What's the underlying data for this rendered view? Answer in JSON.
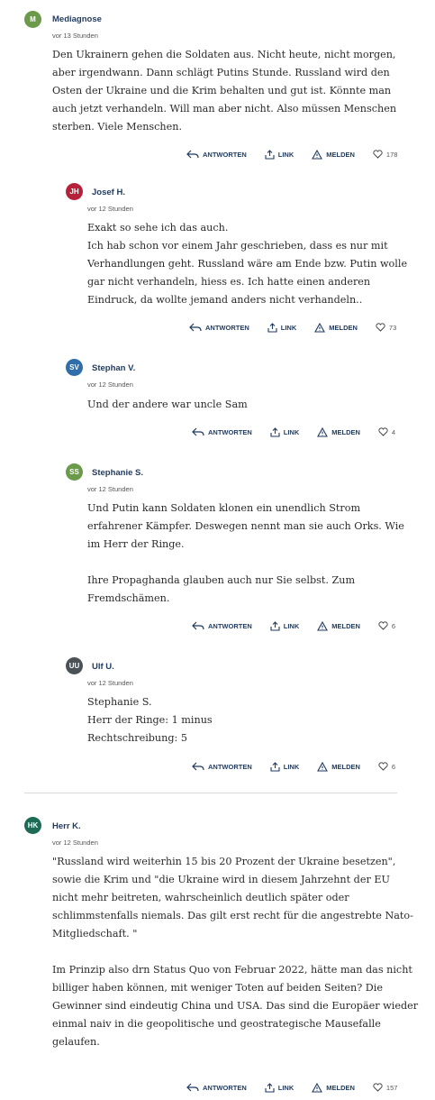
{
  "labels": {
    "reply": "ANTWORTEN",
    "link": "LINK",
    "report": "MELDEN"
  },
  "comments": [
    {
      "initials": "M",
      "avatar_color": "#6a9a4a",
      "author": "Mediagnose",
      "time": "vor 13 Stunden",
      "lines": [
        "Den Ukrainern gehen die Soldaten aus. Nicht heute, nicht morgen,",
        "aber irgendwann. Dann schlägt Putins Stunde. Russland wird den",
        "Osten der Ukraine und die Krim behalten und gut ist. Könnte man",
        "auch jetzt verhandeln. Will man aber nicht. Also müssen Menschen",
        "sterben. Viele Menschen."
      ],
      "likes": "178"
    },
    {
      "initials": "JH",
      "avatar_color": "#b5213a",
      "author": "Josef H.",
      "time": "vor 12 Stunden",
      "lines": [
        "Exakt so sehe ich das auch.",
        "Ich hab schon vor einem Jahr geschrieben, dass es nur mit",
        "Verhandlungen geht. Russland wäre am Ende bzw. Putin wolle",
        "gar nicht verhandeln, hiess es. Ich hatte einen anderen",
        "Eindruck, da wollte jemand anders nicht verhandeln.."
      ],
      "likes": "73"
    },
    {
      "initials": "SV",
      "avatar_color": "#2f6ea8",
      "author": "Stephan V.",
      "time": "vor 12 Stunden",
      "lines": [
        "Und der andere war uncle Sam"
      ],
      "likes": "4"
    },
    {
      "initials": "SS",
      "avatar_color": "#6a9a4a",
      "author": "Stephanie S.",
      "time": "vor 12 Stunden",
      "lines": [
        "Und Putin kann Soldaten klonen ein unendlich Strom",
        "erfahrener Kämpfer. Deswegen nennt man sie auch Orks. Wie",
        "im Herr der Ringe.",
        "",
        "Ihre Propaghanda glauben auch nur Sie selbst. Zum",
        "Fremdschämen."
      ],
      "likes": "6"
    },
    {
      "initials": "UU",
      "avatar_color": "#4b5257",
      "author": "Ulf U.",
      "time": "vor 12 Stunden",
      "lines": [
        "Stephanie S.",
        "Herr der Ringe: 1 minus",
        "Rechtschreibung: 5"
      ],
      "likes": "6"
    },
    {
      "initials": "HK",
      "avatar_color": "#1d6b55",
      "author": "Herr K.",
      "time": "vor 12 Stunden",
      "lines": [
        "\"Russland wird weiterhin 15 bis 20 Prozent der Ukraine besetzen\",",
        "sowie die Krim und \"die Ukraine wird in diesem Jahrzehnt der EU",
        "nicht mehr beitreten, wahrscheinlich deutlich später oder",
        "schlimmstenfalls niemals. Das gilt erst recht für die angestrebte Nato-",
        "Mitgliedschaft. \"",
        "",
        "Im Prinzip also drn Status Quo von Februar 2022, hätte man das nicht",
        "billiger haben können, mit weniger Toten auf beiden Seiten? Die",
        "Gewinner sind eindeutig China und USA. Das sind die Europäer wieder",
        "einmal naiv in die geopolitische und geostrategische Mausefalle",
        "gelaufen."
      ],
      "likes": "157"
    }
  ]
}
